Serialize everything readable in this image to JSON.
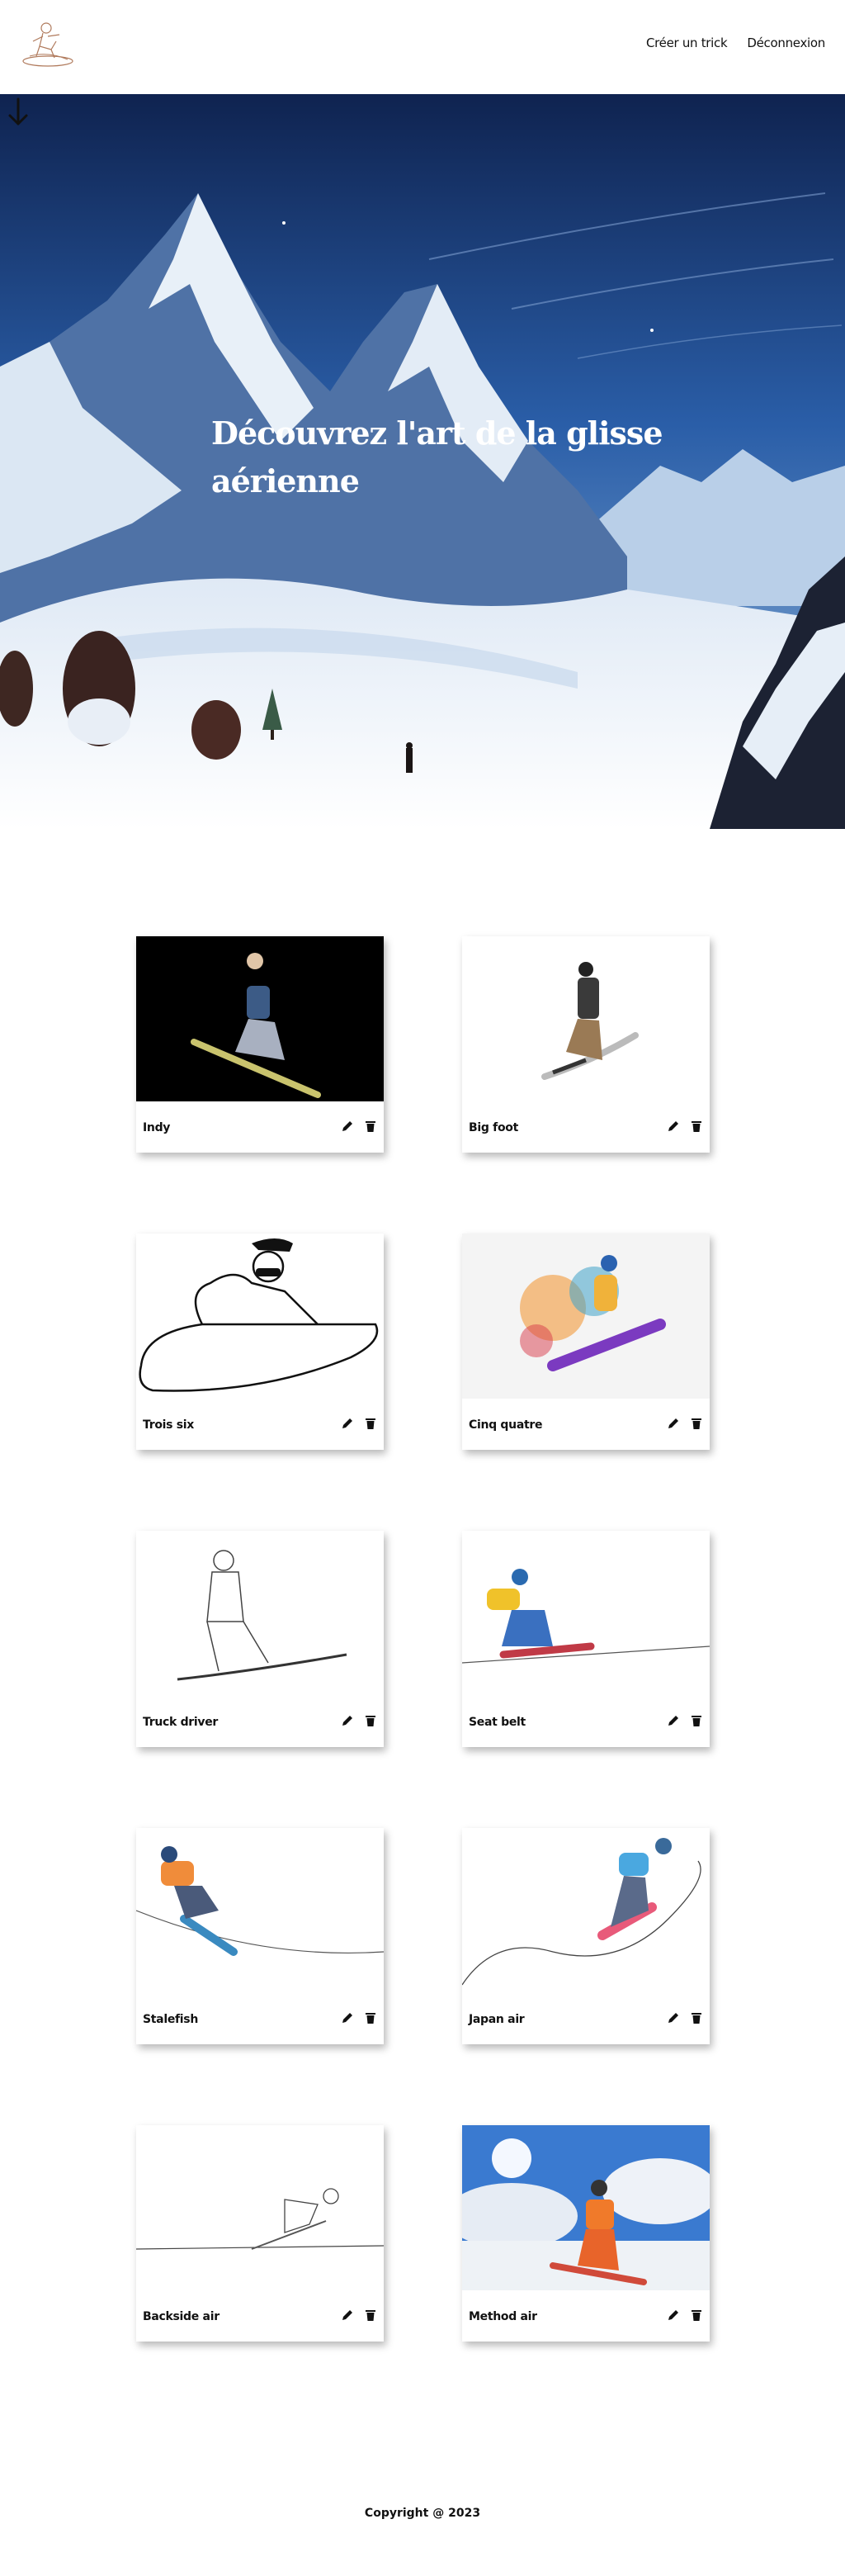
{
  "header": {
    "logo": "snowboarder-logo",
    "nav": [
      {
        "label": "Créer un trick"
      },
      {
        "label": "Déconnexion"
      }
    ]
  },
  "hero": {
    "title_line1": "Découvrez l'art de la glisse",
    "title_line2": "aérienne",
    "scroll_icon": "arrow-down-icon"
  },
  "tricks": [
    {
      "name": "Indy"
    },
    {
      "name": "Big foot"
    },
    {
      "name": "Trois six"
    },
    {
      "name": "Cinq quatre"
    },
    {
      "name": "Truck driver"
    },
    {
      "name": "Seat belt"
    },
    {
      "name": "Stalefish"
    },
    {
      "name": "Japan air"
    },
    {
      "name": "Backside air"
    },
    {
      "name": "Method air"
    }
  ],
  "card_actions": {
    "edit_icon": "pencil-icon",
    "delete_icon": "trash-icon"
  },
  "footer": {
    "copyright": "Copyright @ 2023"
  }
}
